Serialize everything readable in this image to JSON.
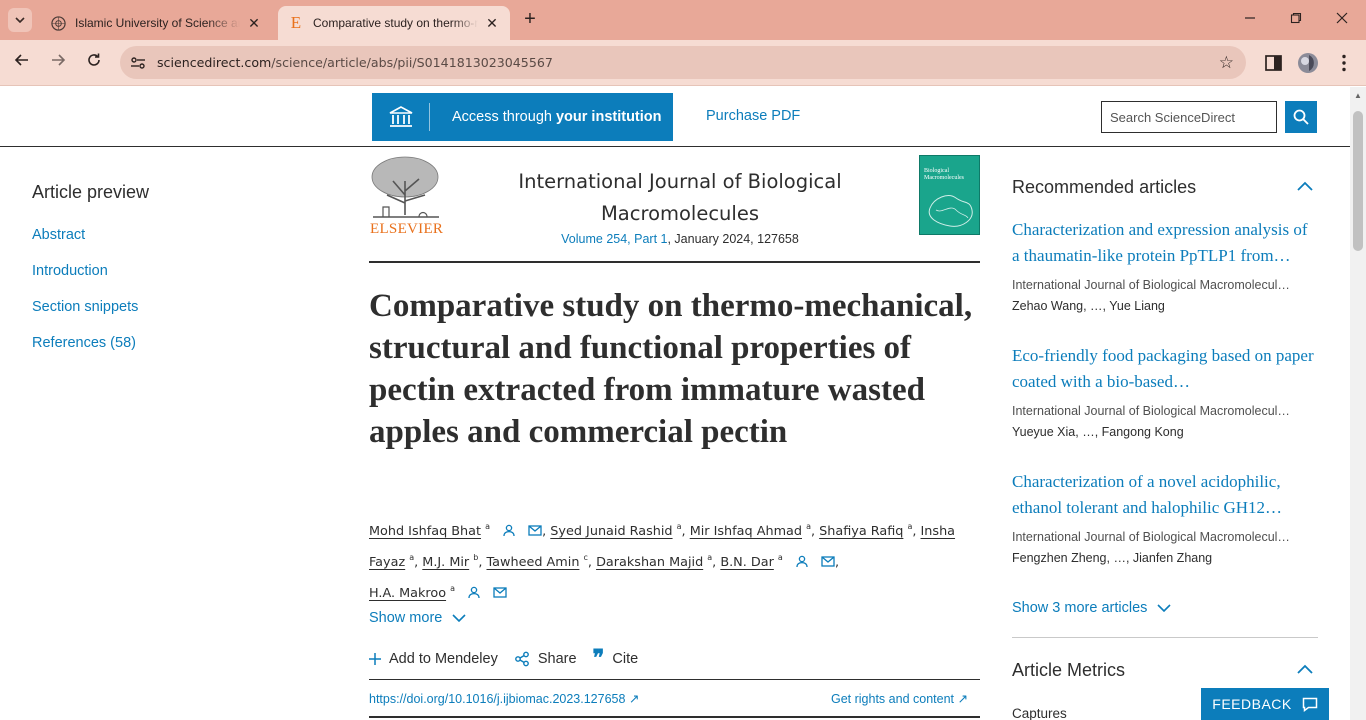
{
  "browser": {
    "tabs": [
      {
        "title": "Islamic University of Science an",
        "favicon": "iust-seal-icon"
      },
      {
        "title": "Comparative study on thermo-m",
        "favicon": "elsevier-e-icon",
        "active": true
      }
    ],
    "url_host": "sciencedirect.com",
    "url_path": "/science/article/abs/pii/S0141813023045567",
    "theme_color": "#e8a898"
  },
  "header": {
    "access_prefix": "Access through ",
    "access_bold": "your institution",
    "purchase": "Purchase PDF",
    "search_placeholder": "Search ScienceDirect",
    "accent_color": "#0c7dbb"
  },
  "sidebar": {
    "title": "Article preview",
    "items": [
      {
        "label": "Abstract"
      },
      {
        "label": "Introduction"
      },
      {
        "label": "Section snippets"
      },
      {
        "label": "References (58)"
      }
    ]
  },
  "journal": {
    "publisher": "ELSEVIER",
    "title": "International Journal of Biological Macromolecules",
    "volume_link": "Volume 254, Part 1",
    "date_id": ", January 2024, 127658",
    "cover_title": "Biological Macromolecules"
  },
  "article": {
    "title": "Comparative study on thermo-mechanical, structural and functional properties of pectin extracted from immature wasted apples and commercial pectin",
    "authors": [
      {
        "name": "Mohd Ishfaq Bhat",
        "aff": "a",
        "icons": true
      },
      {
        "name": "Syed Junaid Rashid",
        "aff": "a"
      },
      {
        "name": "Mir Ishfaq Ahmad",
        "aff": "a"
      },
      {
        "name": "Shafiya Rafiq",
        "aff": "a"
      },
      {
        "name": "Insha Fayaz",
        "aff": "a"
      },
      {
        "name": "M.J. Mir",
        "aff": "b"
      },
      {
        "name": "Tawheed Amin",
        "aff": "c"
      },
      {
        "name": "Darakshan Majid",
        "aff": "a"
      },
      {
        "name": "B.N. Dar",
        "aff": "a",
        "icons": true
      },
      {
        "name": "H.A. Makroo",
        "aff": "a",
        "icons": true
      }
    ],
    "show_more": "Show more",
    "actions": {
      "mendeley": "Add to Mendeley",
      "share": "Share",
      "cite": "Cite"
    },
    "doi": "https://doi.org/10.1016/j.ijbiomac.2023.127658",
    "rights": "Get rights and content"
  },
  "recommended": {
    "title": "Recommended articles",
    "items": [
      {
        "title": "Characterization and expression analysis of a thaumatin-like protein PpTLP1 from…",
        "journal": "International Journal of Biological Macromolecul…",
        "authors": "Zehao Wang, …, Yue Liang"
      },
      {
        "title": "Eco-friendly food packaging based on paper coated with a bio-based…",
        "journal": "International Journal of Biological Macromolecul…",
        "authors": "Yueyue Xia, …, Fangong Kong"
      },
      {
        "title": "Characterization of a novel acidophilic, ethanol tolerant and halophilic GH12…",
        "journal": "International Journal of Biological Macromolecul…",
        "authors": "Fengzhen Zheng, …, Jianfen Zhang"
      }
    ],
    "show_more": "Show 3 more articles"
  },
  "metrics": {
    "title": "Article Metrics",
    "captures": "Captures"
  },
  "feedback": "FEEDBACK"
}
